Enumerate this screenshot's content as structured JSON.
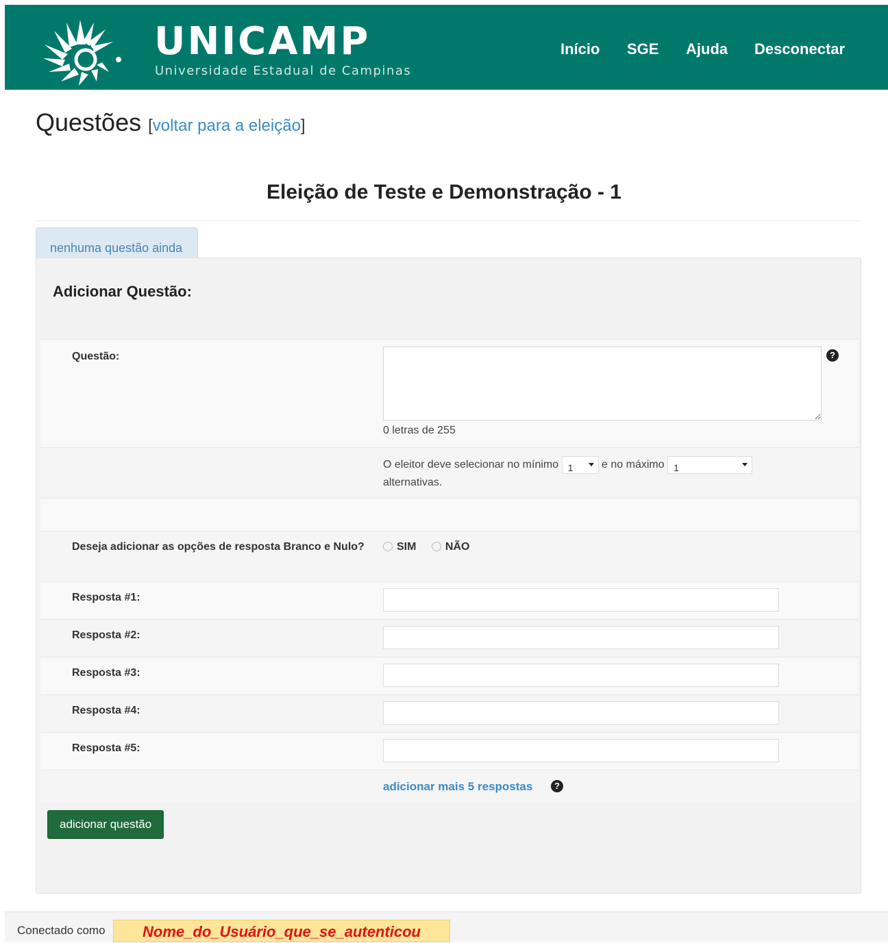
{
  "header": {
    "brand": "UNICAMP",
    "brand_sub": "Universidade Estadual de Campinas",
    "nav": [
      "Início",
      "SGE",
      "Ajuda",
      "Desconectar"
    ],
    "color": "#00796b"
  },
  "page": {
    "title": "Questões",
    "back_open": "[",
    "back_link": "voltar para a eleição",
    "back_close": "]",
    "election_title": "Eleição de Teste e Demonstração - 1"
  },
  "tab": {
    "label": "nenhuma questão ainda"
  },
  "form": {
    "heading": "Adicionar Questão:",
    "question_label": "Questão:",
    "question_value": "",
    "help_glyph": "?",
    "counter": "0 letras de 255",
    "minmax_prefix": "O eleitor deve selecionar no mínimo",
    "min_value": "1",
    "minmax_middle": "e no máximo",
    "max_value": "1",
    "minmax_suffix": "alternativas.",
    "blank_null_label": "Deseja adicionar as opções de resposta Branco e Nulo?",
    "opt_yes": "SIM",
    "opt_no": "NÃO",
    "responses": [
      {
        "label": "Resposta #1:",
        "value": ""
      },
      {
        "label": "Resposta #2:",
        "value": ""
      },
      {
        "label": "Resposta #3:",
        "value": ""
      },
      {
        "label": "Resposta #4:",
        "value": ""
      },
      {
        "label": "Resposta #5:",
        "value": ""
      }
    ],
    "more_link": "adicionar mais 5 respostas",
    "submit": "adicionar questão",
    "submit_color": "#1f6b3b"
  },
  "footer": {
    "label": "Conectado como",
    "user": "Nome_do_Usuário_que_se_autenticou"
  }
}
